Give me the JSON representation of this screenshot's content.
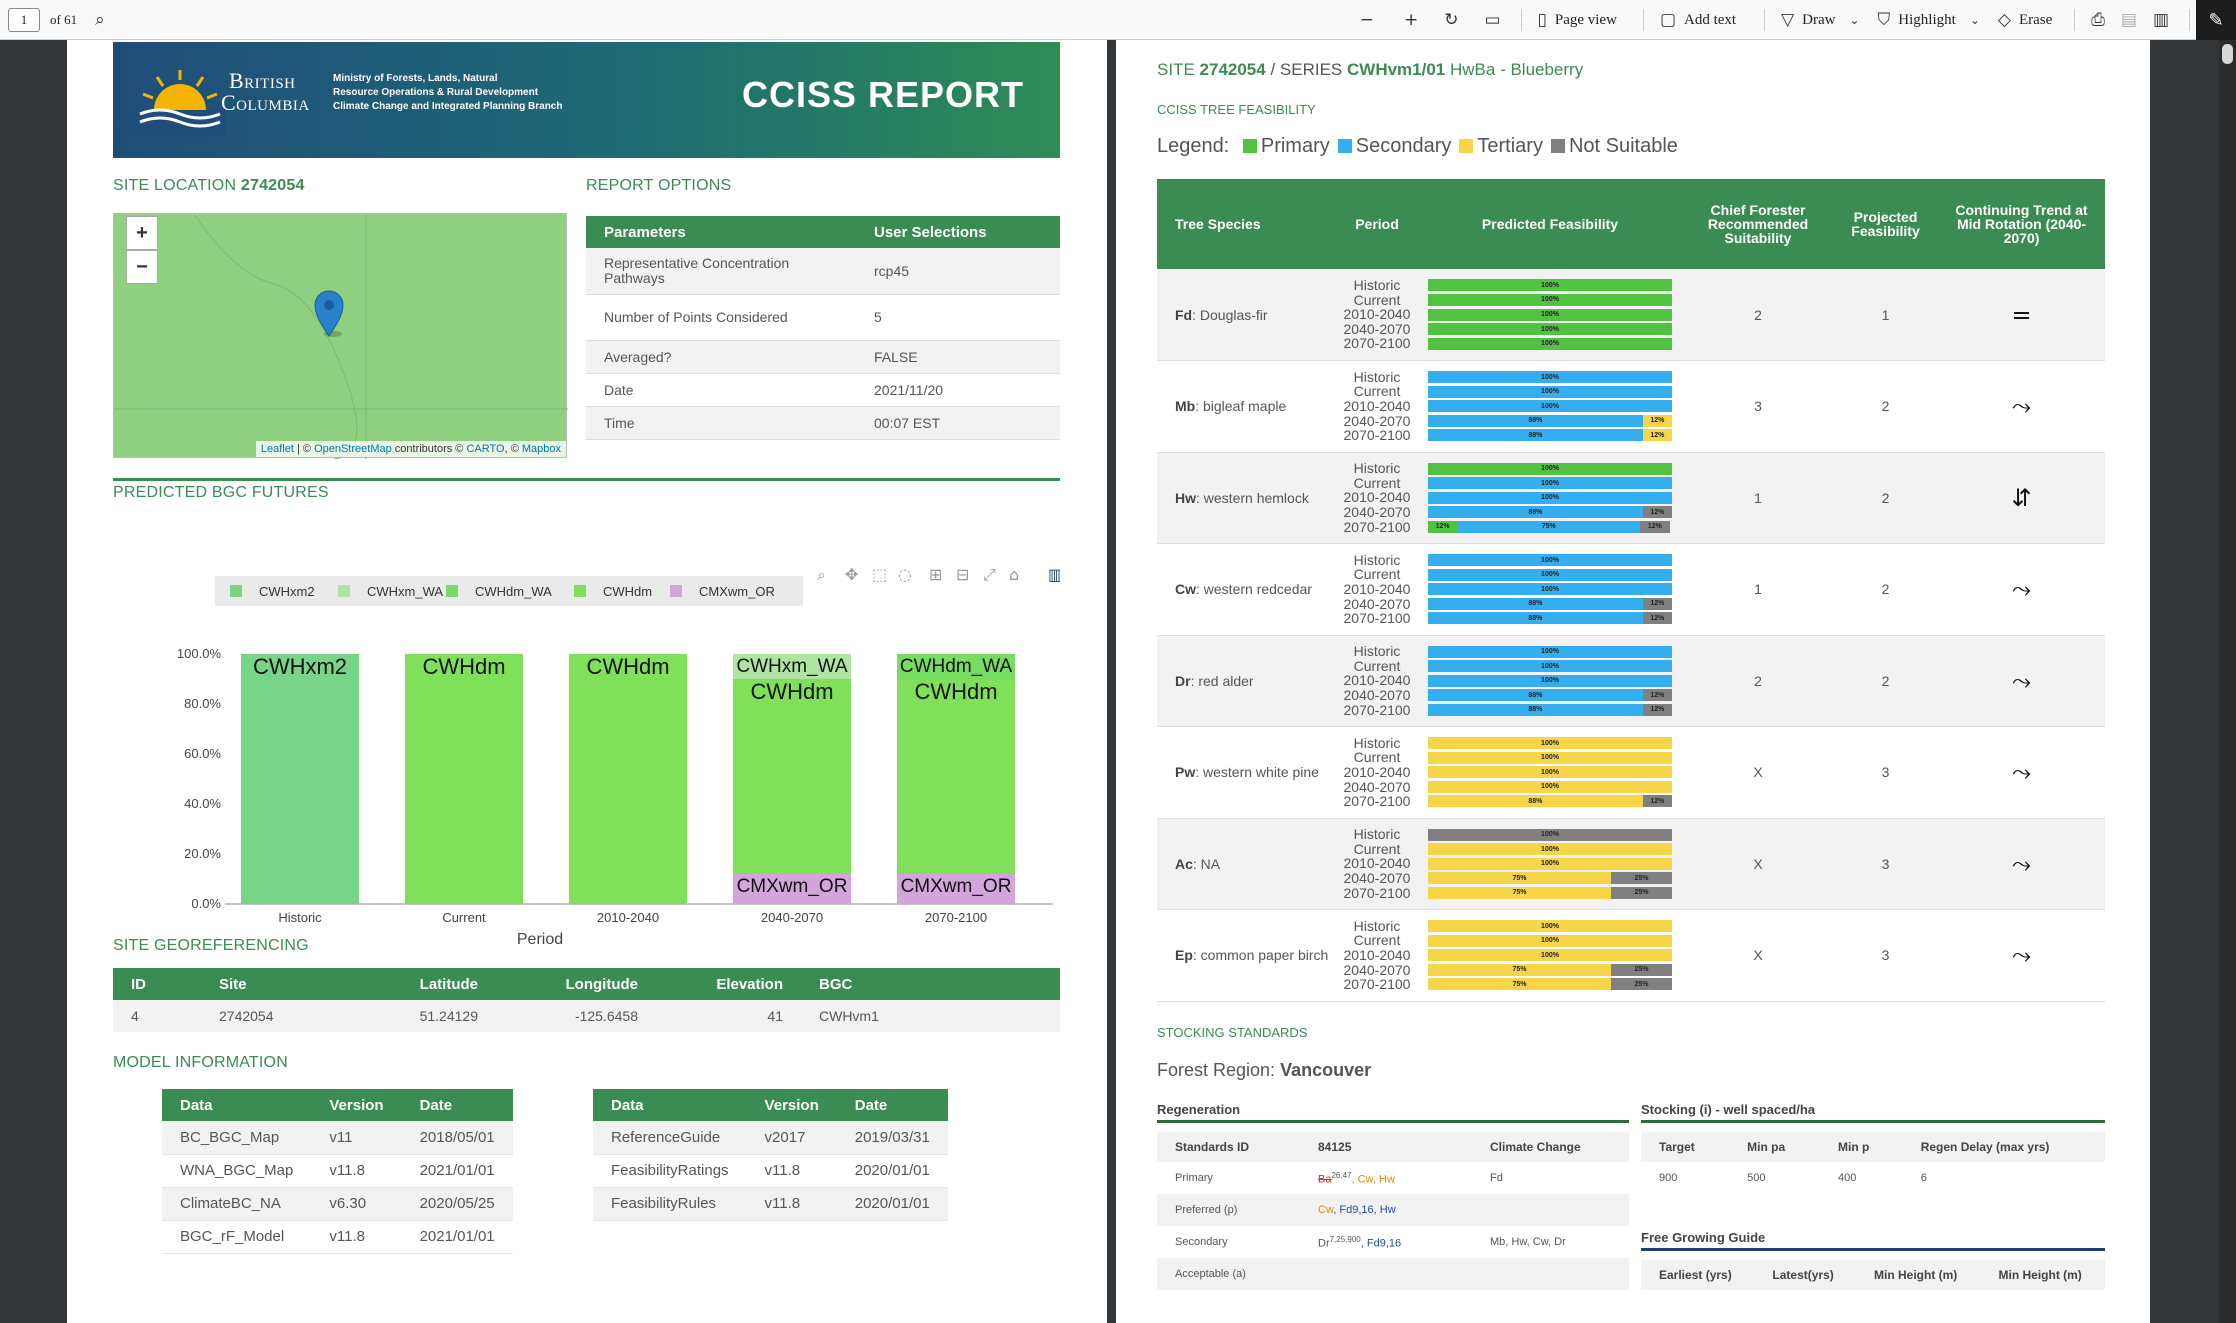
{
  "toolbar": {
    "page_current": "1",
    "page_total": "of 61",
    "page_view": "Page view",
    "add_text": "Add text",
    "draw": "Draw",
    "highlight": "Highlight",
    "erase": "Erase"
  },
  "banner": {
    "bc_line1": "British",
    "bc_line2": "Columbia",
    "ministry_line1": "Ministry of Forests, Lands, Natural",
    "ministry_line2": "Resource Operations & Rural Development",
    "ministry_line3": "Climate Change and Integrated Planning Branch",
    "title": "CCISS REPORT"
  },
  "site_location": {
    "label": "SITE LOCATION",
    "id": "2742054"
  },
  "map": {
    "zoom_in": "+",
    "zoom_out": "−",
    "attr_leaflet": "Leaflet",
    "attr_sep1": " | © ",
    "attr_osm": "OpenStreetMap",
    "attr_mid": " contributors © ",
    "attr_carto": "CARTO",
    "attr_sep2": ", © ",
    "attr_mapbox": "Mapbox"
  },
  "report_options": {
    "label": "REPORT OPTIONS",
    "headers": [
      "Parameters",
      "User Selections"
    ],
    "rows": [
      {
        "param": "Representative Concentration Pathways",
        "value": "rcp45"
      },
      {
        "param": "Number of Points Considered",
        "value": "5"
      },
      {
        "param": "Averaged?",
        "value": "FALSE"
      },
      {
        "param": "Date",
        "value": "2021/11/20"
      },
      {
        "param": "Time",
        "value": "00:07 EST"
      }
    ]
  },
  "bgc_label": "PREDICTED BGC FUTURES",
  "chart_data": {
    "type": "bar",
    "stacked": true,
    "categories": [
      "Historic",
      "Current",
      "2010-2040",
      "2040-2070",
      "2070-2100"
    ],
    "xlabel": "Period",
    "ylabel": "",
    "ylim": [
      0,
      100
    ],
    "yticks": [
      "0.0%",
      "20.0%",
      "40.0%",
      "60.0%",
      "80.0%",
      "100.0%"
    ],
    "legend_position": "top-left",
    "series": [
      {
        "name": "CMXwm_OR",
        "color": "#d4a4dc",
        "values": [
          0,
          0,
          0,
          12,
          12
        ]
      },
      {
        "name": "CWHdm",
        "color": "#80e05a",
        "values": [
          0,
          100,
          100,
          78,
          78
        ]
      },
      {
        "name": "CWHdm_WA",
        "color": "#76dc62",
        "values": [
          0,
          0,
          0,
          0,
          10
        ]
      },
      {
        "name": "CWHxm_WA",
        "color": "#b0e4a2",
        "values": [
          0,
          0,
          0,
          10,
          0
        ]
      },
      {
        "name": "CWHxm2",
        "color": "#78d488",
        "values": [
          100,
          0,
          0,
          0,
          0
        ]
      }
    ],
    "legend": [
      "CWHxm2",
      "CWHxm_WA",
      "CWHdm_WA",
      "CWHdm",
      "CMXwm_OR"
    ]
  },
  "georef": {
    "label": "SITE GEOREFERENCING",
    "headers": [
      "ID",
      "Site",
      "Latitude",
      "Longitude",
      "Elevation",
      "BGC"
    ],
    "row": [
      "4",
      "2742054",
      "51.24129",
      "-125.6458",
      "41",
      "CWHvm1"
    ]
  },
  "model_info": {
    "label": "MODEL INFORMATION",
    "headers": [
      "Data",
      "Version",
      "Date"
    ],
    "left": [
      [
        "BC_BGC_Map",
        "v11",
        "2018/05/01"
      ],
      [
        "WNA_BGC_Map",
        "v11.8",
        "2021/01/01"
      ],
      [
        "ClimateBC_NA",
        "v6.30",
        "2020/05/25"
      ],
      [
        "BGC_rF_Model",
        "v11.8",
        "2021/01/01"
      ]
    ],
    "right": [
      [
        "ReferenceGuide",
        "v2017",
        "2019/03/31"
      ],
      [
        "FeasibilityRatings",
        "v11.8",
        "2020/01/01"
      ],
      [
        "FeasibilityRules",
        "v11.8",
        "2020/01/01"
      ]
    ]
  },
  "page2": {
    "site_prefix": "SITE",
    "site_id": "2742054",
    "series_sep": "/ SERIES",
    "series": "CWHvm1/01",
    "series_name": "HwBa - Blueberry",
    "feas_label": "CCISS TREE FEASIBILITY",
    "legend_label": "Legend:",
    "legend": [
      {
        "name": "Primary",
        "color": "#52c243"
      },
      {
        "name": "Secondary",
        "color": "#35aef0"
      },
      {
        "name": "Tertiary",
        "color": "#f7d548"
      },
      {
        "name": "Not Suitable",
        "color": "#808080"
      }
    ],
    "headers": [
      "Tree Species",
      "Period",
      "Predicted Feasibility",
      "Chief Forester Recommended Suitability",
      "Projected Feasibility",
      "Continuing Trend at Mid Rotation (2040-2070)"
    ],
    "periods": [
      "Historic",
      "Current",
      "2010-2040",
      "2040-2070",
      "2070-2100"
    ],
    "species": [
      {
        "code": "Fd",
        "name": ": Douglas-fir",
        "cf": "2",
        "proj": "1",
        "trend": "=",
        "bars": [
          [
            [
              "p",
              100
            ]
          ],
          [
            [
              "p",
              100
            ]
          ],
          [
            [
              "p",
              100
            ]
          ],
          [
            [
              "p",
              100
            ]
          ],
          [
            [
              "p",
              100
            ]
          ]
        ]
      },
      {
        "code": "Mb",
        "name": ": bigleaf maple",
        "cf": "3",
        "proj": "2",
        "trend": "⤳",
        "bars": [
          [
            [
              "s",
              100
            ]
          ],
          [
            [
              "s",
              100
            ]
          ],
          [
            [
              "s",
              100
            ]
          ],
          [
            [
              "s",
              88
            ],
            [
              "t",
              12
            ]
          ],
          [
            [
              "s",
              88
            ],
            [
              "t",
              12
            ]
          ]
        ]
      },
      {
        "code": "Hw",
        "name": ": western hemlock",
        "cf": "1",
        "proj": "2",
        "trend": "⇵",
        "bars": [
          [
            [
              "p",
              100
            ]
          ],
          [
            [
              "s",
              100
            ]
          ],
          [
            [
              "s",
              100
            ]
          ],
          [
            [
              "s",
              88
            ],
            [
              "n",
              12
            ]
          ],
          [
            [
              "p",
              12
            ],
            [
              "s",
              75
            ],
            [
              "n",
              12
            ]
          ]
        ]
      },
      {
        "code": "Cw",
        "name": ": western redcedar",
        "cf": "1",
        "proj": "2",
        "trend": "⤳",
        "bars": [
          [
            [
              "s",
              100
            ]
          ],
          [
            [
              "s",
              100
            ]
          ],
          [
            [
              "s",
              100
            ]
          ],
          [
            [
              "s",
              88
            ],
            [
              "n",
              12
            ]
          ],
          [
            [
              "s",
              88
            ],
            [
              "n",
              12
            ]
          ]
        ]
      },
      {
        "code": "Dr",
        "name": ": red alder",
        "cf": "2",
        "proj": "2",
        "trend": "⤳",
        "bars": [
          [
            [
              "s",
              100
            ]
          ],
          [
            [
              "s",
              100
            ]
          ],
          [
            [
              "s",
              100
            ]
          ],
          [
            [
              "s",
              88
            ],
            [
              "n",
              12
            ]
          ],
          [
            [
              "s",
              88
            ],
            [
              "n",
              12
            ]
          ]
        ]
      },
      {
        "code": "Pw",
        "name": ": western white pine",
        "cf": "X",
        "proj": "3",
        "trend": "⤳",
        "bars": [
          [
            [
              "t",
              100
            ]
          ],
          [
            [
              "t",
              100
            ]
          ],
          [
            [
              "t",
              100
            ]
          ],
          [
            [
              "t",
              100
            ]
          ],
          [
            [
              "t",
              88
            ],
            [
              "n",
              12
            ]
          ]
        ]
      },
      {
        "code": "Ac",
        "name": ": NA",
        "cf": "X",
        "proj": "3",
        "trend": "⤳",
        "bars": [
          [
            [
              "n",
              100
            ]
          ],
          [
            [
              "t",
              100
            ]
          ],
          [
            [
              "t",
              100
            ]
          ],
          [
            [
              "t",
              75
            ],
            [
              "n",
              25
            ]
          ],
          [
            [
              "t",
              75
            ],
            [
              "n",
              25
            ]
          ]
        ]
      },
      {
        "code": "Ep",
        "name": ": common paper birch",
        "cf": "X",
        "proj": "3",
        "trend": "⤳",
        "bars": [
          [
            [
              "t",
              100
            ]
          ],
          [
            [
              "t",
              100
            ]
          ],
          [
            [
              "t",
              100
            ]
          ],
          [
            [
              "t",
              75
            ],
            [
              "n",
              25
            ]
          ],
          [
            [
              "t",
              75
            ],
            [
              "n",
              25
            ]
          ]
        ]
      }
    ],
    "stocking_label": "STOCKING STANDARDS",
    "forest_region_label": "Forest Region:",
    "forest_region": "Vancouver",
    "regen_label": "Regeneration",
    "regen_headers": [
      "Standards ID",
      "84125",
      "Climate Change"
    ],
    "regen_rows": [
      {
        "label": "Primary",
        "species": "Ba",
        "sup": "26,47",
        "rest": ", Cw, Hw",
        "cc": "Fd"
      },
      {
        "label": "Preferred (p)",
        "species": "Cw",
        "sup": "",
        "rest": ", Fd9,16, Hw",
        "cc": ""
      },
      {
        "label": "Secondary",
        "species": "Dr",
        "sup": "7,25,900",
        "rest": ", Fd9,16",
        "cc": "Mb, Hw, Cw, Dr"
      },
      {
        "label": "Acceptable (a)",
        "species": "",
        "sup": "",
        "rest": "",
        "cc": ""
      }
    ],
    "stocking_label2": "Stocking (i) - well spaced/ha",
    "stocking_headers": [
      "Target",
      "Min pa",
      "Min p",
      "Regen Delay (max yrs)"
    ],
    "stocking_row": [
      "900",
      "500",
      "400",
      "6"
    ],
    "fg_label": "Free Growing Guide",
    "fg_headers": [
      "Earliest (yrs)",
      "Latest(yrs)",
      "Min Height (m)",
      "Min Height (m)"
    ]
  }
}
